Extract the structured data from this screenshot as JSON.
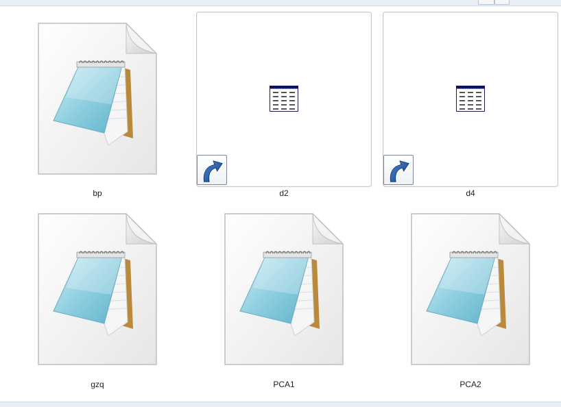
{
  "window": {
    "icons": [
      {
        "label": "bp",
        "type": "text-document",
        "icon": "notepad-document-icon"
      },
      {
        "label": "d2",
        "type": "shortcut",
        "icon": "table-shortcut-icon"
      },
      {
        "label": "d4",
        "type": "shortcut",
        "icon": "table-shortcut-icon"
      },
      {
        "label": "gzq",
        "type": "text-document",
        "icon": "notepad-document-icon"
      },
      {
        "label": "PCA1",
        "type": "text-document",
        "icon": "notepad-document-icon"
      },
      {
        "label": "PCA2",
        "type": "text-document",
        "icon": "notepad-document-icon"
      }
    ]
  }
}
